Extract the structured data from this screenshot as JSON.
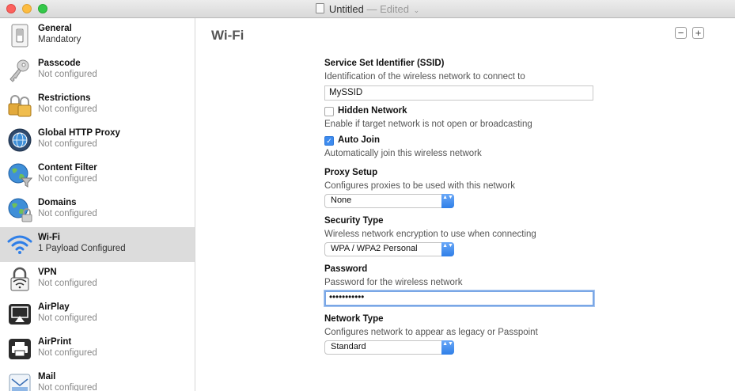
{
  "window": {
    "title": "Untitled",
    "edited": "— Edited",
    "chevron": "⌄"
  },
  "sidebar": {
    "items": [
      {
        "name": "General",
        "sub": "Mandatory",
        "icon": "switch-icon"
      },
      {
        "name": "Passcode",
        "sub": "Not configured",
        "icon": "key-icon"
      },
      {
        "name": "Restrictions",
        "sub": "Not configured",
        "icon": "padlocks-icon"
      },
      {
        "name": "Global HTTP Proxy",
        "sub": "Not configured",
        "icon": "globe-proxy-icon"
      },
      {
        "name": "Content Filter",
        "sub": "Not configured",
        "icon": "globe-filter-icon"
      },
      {
        "name": "Domains",
        "sub": "Not configured",
        "icon": "globe-lock-icon"
      },
      {
        "name": "Wi-Fi",
        "sub": "1 Payload Configured",
        "icon": "wifi-icon"
      },
      {
        "name": "VPN",
        "sub": "Not configured",
        "icon": "vpn-lock-icon"
      },
      {
        "name": "AirPlay",
        "sub": "Not configured",
        "icon": "airplay-icon"
      },
      {
        "name": "AirPrint",
        "sub": "Not configured",
        "icon": "printer-icon"
      },
      {
        "name": "Mail",
        "sub": "Not configured",
        "icon": "mail-icon"
      }
    ]
  },
  "main": {
    "title": "Wi-Fi",
    "minus": "−",
    "plus": "+",
    "ssid": {
      "label": "Service Set Identifier (SSID)",
      "desc": "Identification of the wireless network to connect to",
      "value": "MySSID"
    },
    "hidden": {
      "label": "Hidden Network",
      "desc": "Enable if target network is not open or broadcasting",
      "checked": false
    },
    "autojoin": {
      "label": "Auto Join",
      "desc": "Automatically join this wireless network",
      "checked": true,
      "mark": "✓"
    },
    "proxy": {
      "label": "Proxy Setup",
      "desc": "Configures proxies to be used with this network",
      "value": "None"
    },
    "security": {
      "label": "Security Type",
      "desc": "Wireless network encryption to use when connecting",
      "value": "WPA / WPA2 Personal"
    },
    "password": {
      "label": "Password",
      "desc": "Password for the wireless network",
      "value": "•••••••••••"
    },
    "network": {
      "label": "Network Type",
      "desc": "Configures network to appear as legacy or Passpoint",
      "value": "Standard"
    },
    "stepper_glyph": "▲▼"
  },
  "colors": {
    "accent": "#3d8bef",
    "selected_row": "#dcdcdc"
  }
}
